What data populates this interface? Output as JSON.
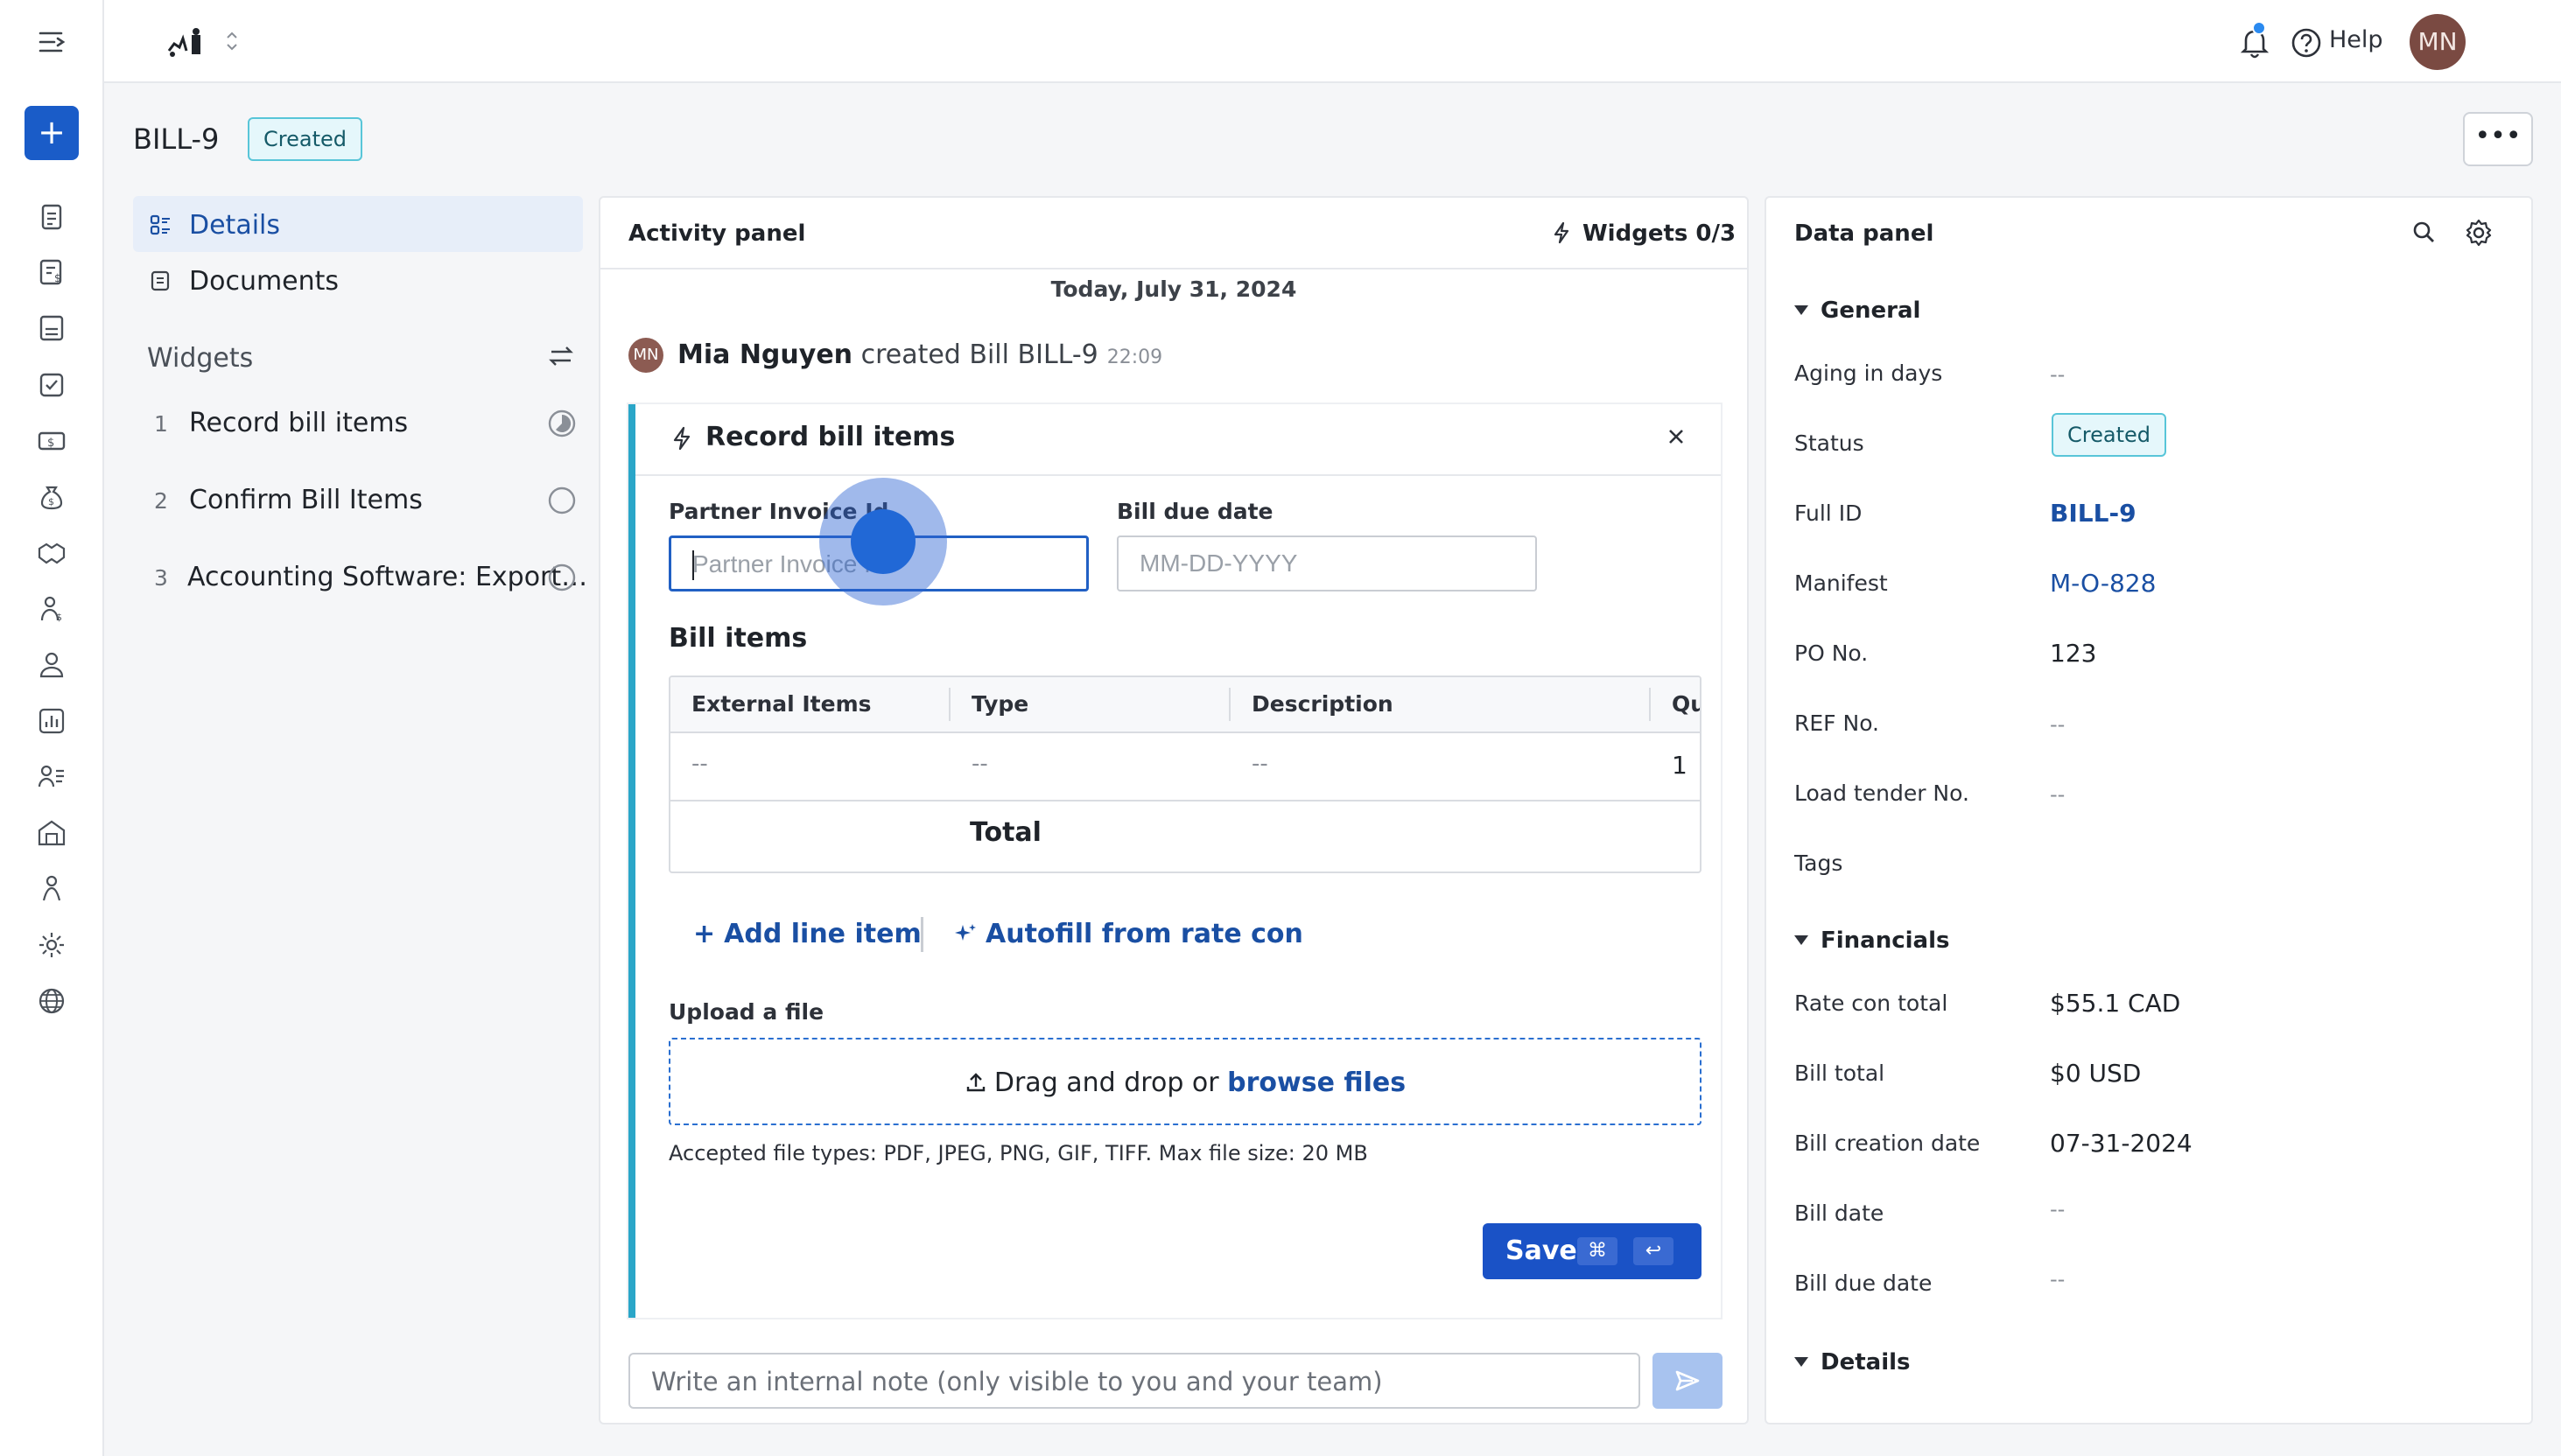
{
  "topbar": {
    "help_label": "Help",
    "avatar_initials": "MN"
  },
  "rail": {
    "new_label": "+"
  },
  "header": {
    "bill_id": "BILL-9",
    "status": "Created",
    "more_label": "•••"
  },
  "left_nav": {
    "items": [
      {
        "label": "Details"
      },
      {
        "label": "Documents"
      }
    ],
    "widgets_heading": "Widgets",
    "widgets": [
      {
        "num": "1",
        "label": "Record bill items"
      },
      {
        "num": "2",
        "label": "Confirm Bill Items"
      },
      {
        "num": "3",
        "label": "Accounting Software: Export…"
      }
    ]
  },
  "activity": {
    "title": "Activity panel",
    "widgets_count": "Widgets 0/3",
    "date": "Today, July 31, 2024",
    "event": {
      "avatar": "MN",
      "user": "Mia Nguyen",
      "action": "created Bill BILL-9",
      "time": "22:09"
    },
    "card": {
      "title": "Record bill items",
      "partner_invoice_label": "Partner Invoice Id",
      "partner_invoice_placeholder": "Partner Invoice Id",
      "due_date_label": "Bill due date",
      "due_date_placeholder": "MM-DD-YYYY",
      "bill_items_heading": "Bill items",
      "table": {
        "columns": [
          "External Items",
          "Type",
          "Description",
          "Qu"
        ],
        "row": [
          "--",
          "--",
          "--",
          "1"
        ],
        "total_label": "Total"
      },
      "add_line_item": "Add line item",
      "autofill": "Autofill from rate con",
      "upload_label": "Upload a file",
      "drop_text": "Drag and drop or",
      "browse_text": "browse files",
      "accepted": "Accepted file types: PDF, JPEG, PNG, GIF, TIFF. Max file size: 20 MB",
      "save_label": "Save",
      "kbd_cmd": "⌘",
      "kbd_enter": "↩"
    },
    "note_placeholder": "Write an internal note (only visible to you and your team)"
  },
  "data_panel": {
    "title": "Data panel",
    "general_heading": "General",
    "general": [
      {
        "label": "Aging in days",
        "value": "--"
      },
      {
        "label": "Status",
        "value": "Created"
      },
      {
        "label": "Full ID",
        "value": "BILL-9"
      },
      {
        "label": "Manifest",
        "value": "M-O-828"
      },
      {
        "label": "PO No.",
        "value": "123"
      },
      {
        "label": "REF No.",
        "value": "--"
      },
      {
        "label": "Load tender No.",
        "value": "--"
      },
      {
        "label": "Tags",
        "value": ""
      }
    ],
    "financials_heading": "Financials",
    "financials": [
      {
        "label": "Rate con total",
        "value": "$55.1 CAD"
      },
      {
        "label": "Bill total",
        "value": "$0 USD"
      },
      {
        "label": "Bill creation date",
        "value": "07-31-2024"
      },
      {
        "label": "Bill date",
        "value": "--"
      },
      {
        "label": "Bill due date",
        "value": "--"
      }
    ],
    "details_heading": "Details"
  },
  "colors": {
    "accent": "#1a52c6",
    "widget_bar": "#2aa6c8",
    "badge_border": "#58c5d8"
  }
}
